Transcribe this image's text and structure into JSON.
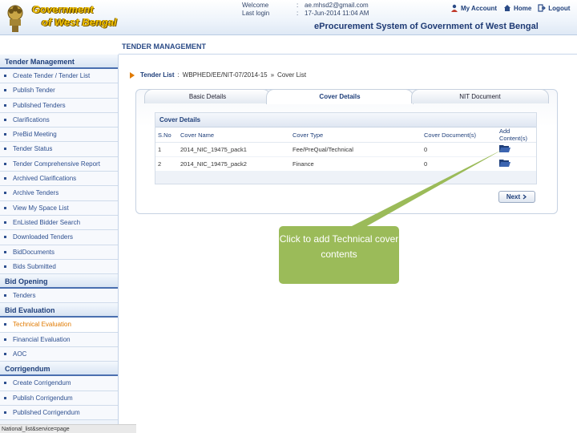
{
  "header": {
    "govt_line1": "Government",
    "govt_line2": "of West Bengal",
    "welcome_label": "Welcome",
    "welcome_value": "ae.mhsd2@gmail.com",
    "lastlogin_label": "Last login",
    "lastlogin_value": "17-Jun-2014 11:04 AM",
    "colon": ":",
    "my_account": "My Account",
    "home": "Home",
    "logout": "Logout",
    "system_title": "eProcurement System of Government of West Bengal"
  },
  "section_title": "TENDER MANAGEMENT",
  "sidebar": {
    "groups": [
      {
        "title": "Tender Management",
        "items": [
          "Create Tender / Tender List",
          "Publish Tender",
          "Published Tenders",
          "Clarifications",
          "PreBid Meeting",
          "Tender Status",
          "Tender Comprehensive Report",
          "Archived Clarifications",
          "Archive Tenders",
          "View My Space List",
          "EnListed Bidder Search",
          "Downloaded Tenders",
          "BidDocuments",
          "Bids Submitted"
        ]
      },
      {
        "title": "Bid Opening",
        "items": [
          "Tenders"
        ]
      },
      {
        "title": "Bid Evaluation",
        "items": [
          "Technical Evaluation",
          "Financial Evaluation",
          "AOC"
        ]
      },
      {
        "title": "Corrigendum",
        "items": [
          "Create Corrigendum",
          "Publish Corrigendum",
          "Published Corrigendum"
        ]
      }
    ],
    "active_item": "Technical Evaluation"
  },
  "breadcrumb": {
    "part1": "Tender List",
    "sep1": ":",
    "part2": "WBPHED/EE/NIT-07/2014-15",
    "sep2": "»",
    "part3": "Cover List"
  },
  "tabs": [
    "Basic Details",
    "Cover Details",
    "NIT Document"
  ],
  "active_tab": "Cover Details",
  "cover_details": {
    "title": "Cover Details",
    "headers": [
      "S.No",
      "Cover Name",
      "Cover Type",
      "Cover Document(s)",
      "Add Content(s)"
    ],
    "rows": [
      {
        "sno": "1",
        "name": "2014_NIC_19475_pack1",
        "type": "Fee/PreQual/Technical",
        "docs": "0"
      },
      {
        "sno": "2",
        "name": "2014_NIC_19475_pack2",
        "type": "Finance",
        "docs": "0"
      }
    ]
  },
  "next_button": "Next",
  "callout_text": "Click to add Technical cover contents",
  "status_text": "National_list&service=page",
  "colors": {
    "accent_blue": "#1f3f7a",
    "callout_green": "#9bbb59",
    "active_orange": "#e07a00"
  }
}
